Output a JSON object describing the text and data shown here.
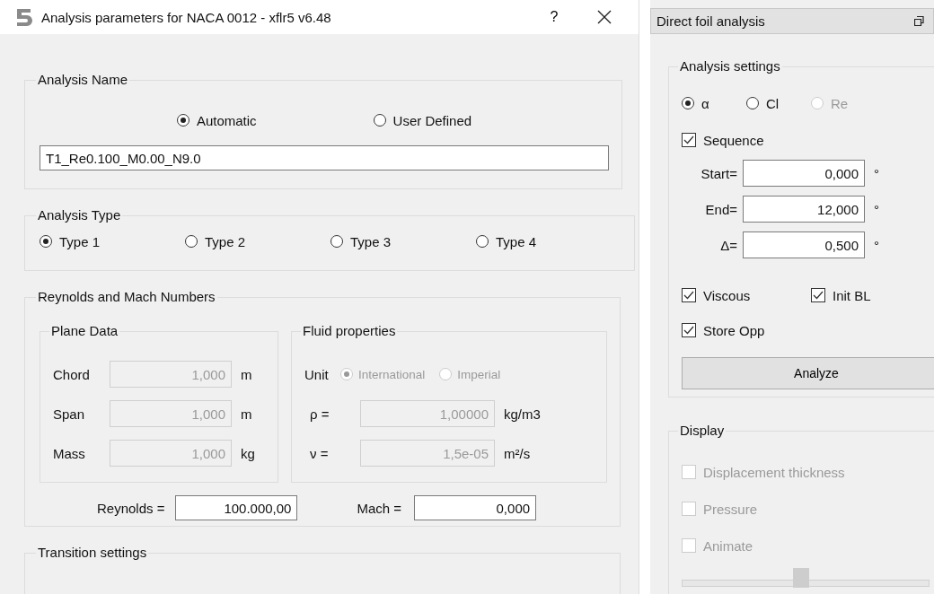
{
  "dialog": {
    "title": "Analysis parameters for NACA 0012 - xflr5 v6.48",
    "help_button": "?",
    "analysis_name": {
      "title": "Analysis Name",
      "options": [
        {
          "label": "Automatic",
          "selected": true
        },
        {
          "label": "User Defined",
          "selected": false
        }
      ],
      "value": "T1_Re0.100_M0.00_N9.0"
    },
    "analysis_type": {
      "title": "Analysis Type",
      "options": [
        {
          "label": "Type 1",
          "selected": true
        },
        {
          "label": "Type 2",
          "selected": false
        },
        {
          "label": "Type 3",
          "selected": false
        },
        {
          "label": "Type 4",
          "selected": false
        }
      ]
    },
    "reynolds_mach": {
      "title": "Reynolds and Mach Numbers",
      "plane_data": {
        "title": "Plane Data",
        "rows": [
          {
            "label": "Chord",
            "value": "1,000",
            "unit": "m",
            "disabled": true
          },
          {
            "label": "Span",
            "value": "1,000",
            "unit": "m",
            "disabled": true
          },
          {
            "label": "Mass",
            "value": "1,000",
            "unit": "kg",
            "disabled": true
          }
        ]
      },
      "fluid": {
        "title": "Fluid properties",
        "unit_label": "Unit",
        "unit_options": [
          {
            "label": "International",
            "selected": true,
            "disabled": true
          },
          {
            "label": "Imperial",
            "selected": false,
            "disabled": true
          }
        ],
        "rows": [
          {
            "label": "ρ =",
            "value": "1,00000",
            "unit": "kg/m3",
            "disabled": true
          },
          {
            "label": "ν =",
            "value": "1,5e-05",
            "unit": "m²/s",
            "disabled": true
          }
        ]
      },
      "reynolds": {
        "label": "Reynolds =",
        "value": "100.000,00"
      },
      "mach": {
        "label": "Mach =",
        "value": "0,000"
      }
    },
    "transition": {
      "title": "Transition settings"
    }
  },
  "panel": {
    "title": "Direct foil analysis",
    "settings": {
      "title": "Analysis settings",
      "modes": [
        {
          "label": "α",
          "selected": true,
          "disabled": false
        },
        {
          "label": "Cl",
          "selected": false,
          "disabled": false
        },
        {
          "label": "Re",
          "selected": false,
          "disabled": true
        }
      ],
      "sequence": {
        "label": "Sequence",
        "checked": true
      },
      "fields": [
        {
          "label": "Start=",
          "value": "0,000",
          "unit": "°"
        },
        {
          "label": "End=",
          "value": "12,000",
          "unit": "°"
        },
        {
          "label": "Δ=",
          "value": "0,500",
          "unit": "°"
        }
      ],
      "options": [
        {
          "label": "Viscous",
          "checked": true
        },
        {
          "label": "Init BL",
          "checked": true
        },
        {
          "label": "Store Opp",
          "checked": true
        }
      ],
      "analyze_button": "Analyze"
    },
    "display": {
      "title": "Display",
      "options": [
        {
          "label": "Displacement thickness",
          "checked": false,
          "disabled": true
        },
        {
          "label": "Pressure",
          "checked": false,
          "disabled": true
        },
        {
          "label": "Animate",
          "checked": false,
          "disabled": true
        }
      ],
      "slider": {
        "level": 0.48
      }
    }
  }
}
